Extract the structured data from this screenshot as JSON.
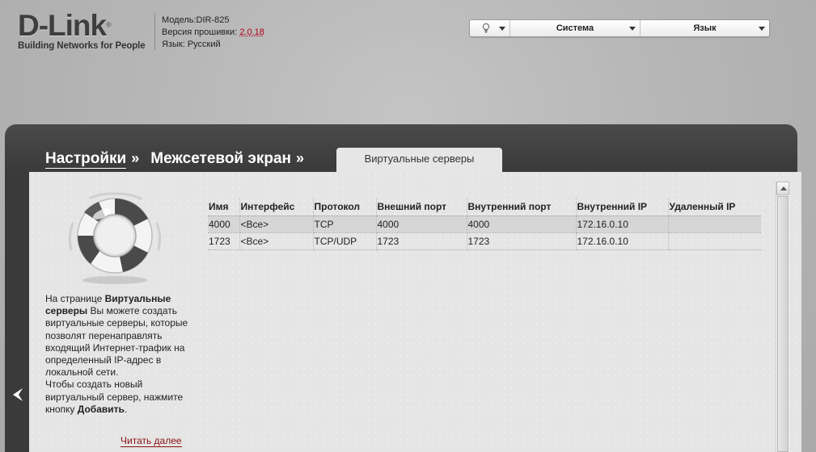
{
  "header": {
    "logo_main": "D-Link",
    "logo_registered": "®",
    "logo_tagline": "Building Networks for People",
    "model_label": "Модель:",
    "model_value": "DIR-825",
    "firmware_label": "Версия прошивки:",
    "firmware_value": "2.0.18",
    "language_label": "Язык:",
    "language_value": "Русский"
  },
  "topbar": {
    "hint_icon": "lightbulb-icon",
    "system_label": "Система",
    "language_label": "Язык"
  },
  "breadcrumb": {
    "item1": "Настройки",
    "sep1": "»",
    "item2": "Межсетевой экран",
    "sep2": "»",
    "active_tab": "Виртуальные серверы"
  },
  "help": {
    "prefix": "На странице ",
    "page_name": "Виртуальные серверы",
    "middle": " Вы можете создать виртуальные серверы, которые позволят перенаправлять входящий Интернет-трафик на определенный IP-адрес в локальной сети.",
    "line2_prefix": "Чтобы создать новый виртуальный сервер, нажмите кнопку ",
    "add_word": "Добавить",
    "line2_suffix": ".",
    "read_more": "Читать далее"
  },
  "table": {
    "headers": [
      "Имя",
      "Интерфейс",
      "Протокол",
      "Внешний порт",
      "Внутренний порт",
      "Внутренний IP",
      "Удаленный IP"
    ],
    "rows": [
      [
        "4000",
        "<Все>",
        "TCP",
        "4000",
        "4000",
        "172.16.0.10",
        ""
      ],
      [
        "1723",
        "<Все>",
        "TCP/UDP",
        "1723",
        "1723",
        "172.16.0.10",
        ""
      ]
    ]
  },
  "colors": {
    "accent_red": "#b3001b",
    "panel_dark": "#3a3a3a",
    "content_bg": "#e5e5e5"
  }
}
